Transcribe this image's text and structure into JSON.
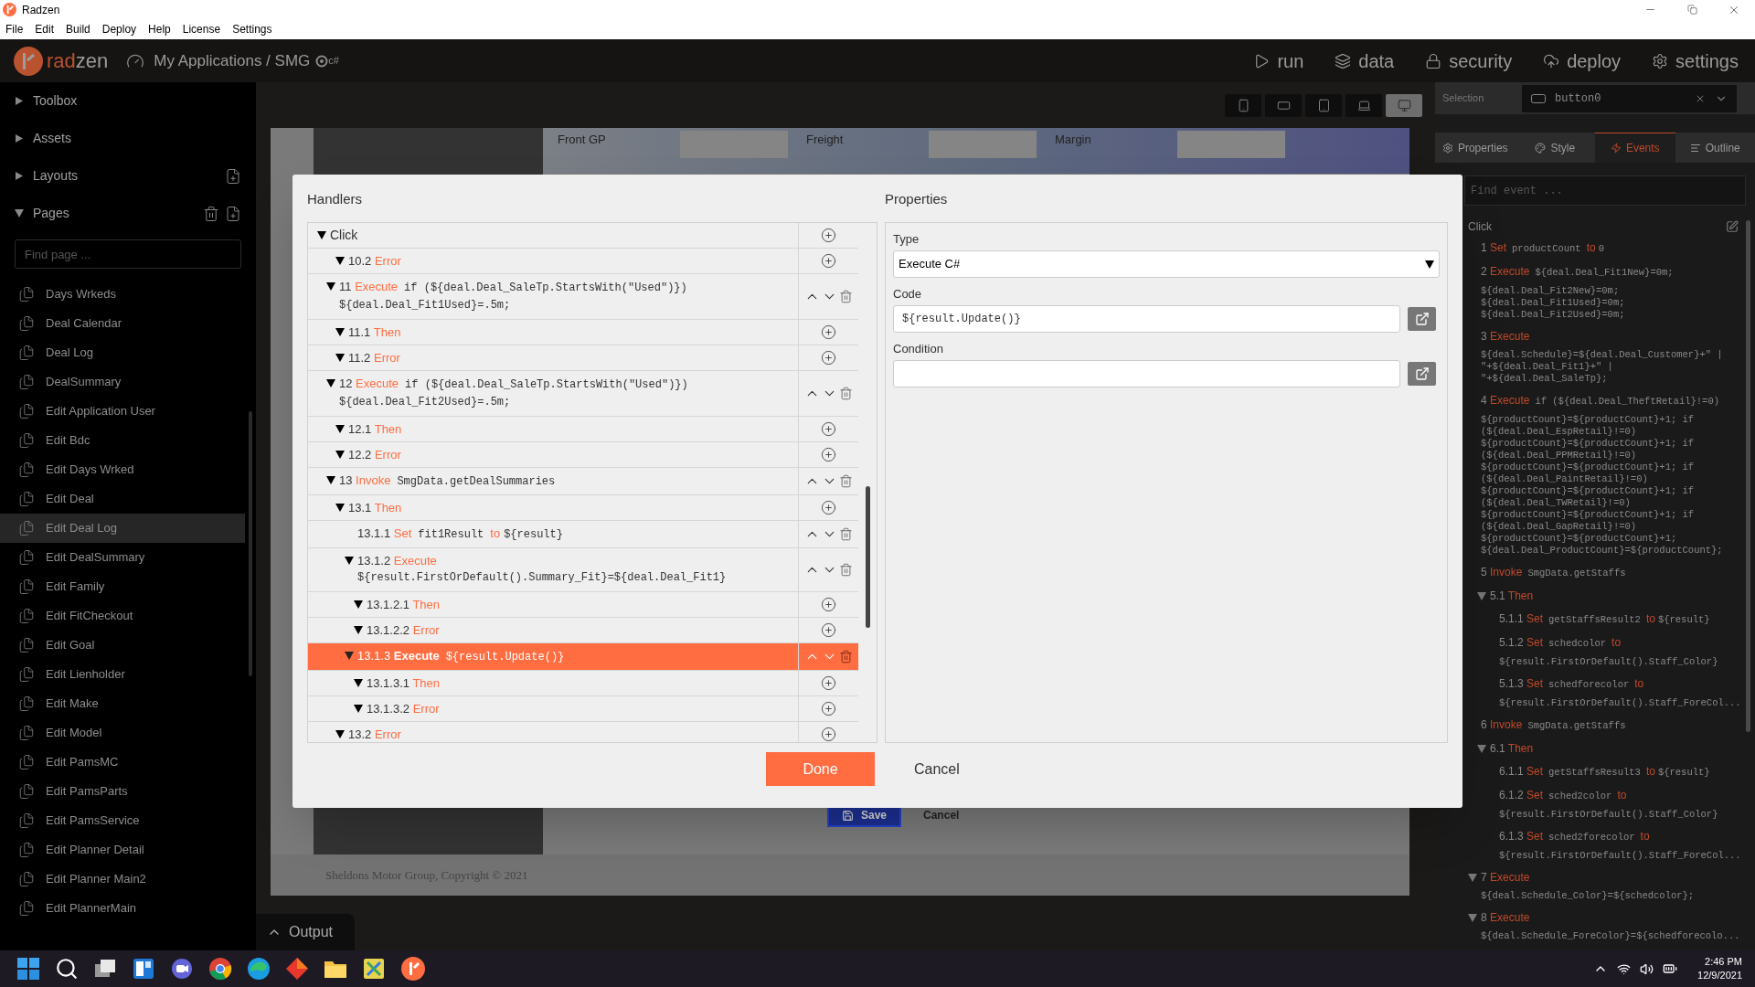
{
  "window": {
    "title": "Radzen"
  },
  "menu": [
    "File",
    "Edit",
    "Build",
    "Deploy",
    "Help",
    "License",
    "Settings"
  ],
  "app_bar": {
    "brand": {
      "accent": "rad",
      "rest": "zen"
    },
    "breadcrumb": "My Applications / SMG",
    "language": "c#",
    "nav": [
      {
        "label": "run"
      },
      {
        "label": "data"
      },
      {
        "label": "security"
      },
      {
        "label": "deploy"
      },
      {
        "label": "settings"
      }
    ]
  },
  "sidebar": {
    "sections": [
      {
        "label": "Toolbox",
        "expanded": false
      },
      {
        "label": "Assets",
        "expanded": false
      },
      {
        "label": "Layouts",
        "expanded": false
      },
      {
        "label": "Pages",
        "expanded": true
      }
    ],
    "search": {
      "placeholder": "Find page ..."
    },
    "pages": [
      {
        "label": "Days Wrkeds",
        "selected": false
      },
      {
        "label": "Deal Calendar",
        "selected": false
      },
      {
        "label": "Deal Log",
        "selected": false
      },
      {
        "label": "DealSummary",
        "selected": false
      },
      {
        "label": "Edit Application User",
        "selected": false
      },
      {
        "label": "Edit Bdc",
        "selected": false
      },
      {
        "label": "Edit Days Wrked",
        "selected": false
      },
      {
        "label": "Edit Deal",
        "selected": false
      },
      {
        "label": "Edit Deal Log",
        "selected": true
      },
      {
        "label": "Edit DealSummary",
        "selected": false
      },
      {
        "label": "Edit Family",
        "selected": false
      },
      {
        "label": "Edit FitCheckout",
        "selected": false
      },
      {
        "label": "Edit Goal",
        "selected": false
      },
      {
        "label": "Edit Lienholder",
        "selected": false
      },
      {
        "label": "Edit Make",
        "selected": false
      },
      {
        "label": "Edit Model",
        "selected": false
      },
      {
        "label": "Edit PamsMC",
        "selected": false
      },
      {
        "label": "Edit PamsParts",
        "selected": false
      },
      {
        "label": "Edit PamsService",
        "selected": false
      },
      {
        "label": "Edit Planner Detail",
        "selected": false
      },
      {
        "label": "Edit Planner Main2",
        "selected": false
      },
      {
        "label": "Edit PlannerMain",
        "selected": false
      }
    ]
  },
  "device_bar": {
    "devices": [
      {
        "selected": false
      },
      {
        "selected": false
      },
      {
        "selected": false
      },
      {
        "selected": false
      },
      {
        "selected": true
      }
    ]
  },
  "canvas": {
    "columns": [
      "Front GP",
      "Freight",
      "Margin"
    ],
    "save_button": "Save",
    "cancel_button": "Cancel",
    "footer": "Sheldons Motor Group, Copyright © 2021"
  },
  "output_tab": {
    "label": "Output"
  },
  "inspector": {
    "selection_label": "Selection",
    "selection_value": "button0",
    "tabs": [
      {
        "label": "Properties",
        "selected": false
      },
      {
        "label": "Style",
        "selected": false
      },
      {
        "label": "Events",
        "selected": true
      },
      {
        "label": "Outline",
        "selected": false
      }
    ],
    "search": {
      "placeholder": "Find event ..."
    },
    "event": "Click",
    "steps": [
      {
        "num": "1",
        "action": "Set",
        "code": "productCount",
        "connector": "to",
        "value": "0"
      },
      {
        "num": "2",
        "action": "Execute",
        "code": "${deal.Deal_Fit1New}=0m;",
        "lines": [
          "${deal.Deal_Fit2New}=0m;",
          "${deal.Deal_Fit1Used}=0m;",
          "${deal.Deal_Fit2Used}=0m;"
        ]
      },
      {
        "num": "3",
        "action": "Execute",
        "lines": [
          "${deal.Schedule}=${deal.Deal_Customer}+\" |",
          "\"+${deal.Deal_Fit1}+\" |",
          "\"+${deal.Deal_SaleTp};"
        ]
      },
      {
        "num": "4",
        "action": "Execute",
        "code": "if (${deal.Deal_TheftRetail}!=0)",
        "lines": [
          "${productCount}=${productCount}+1; if",
          "(${deal.Deal_EspRetail}!=0)",
          "${productCount}=${productCount}+1; if",
          "(${deal.Deal_PPMRetail}!=0)",
          "${productCount}=${productCount}+1; if",
          "(${deal.Deal_PaintRetail}!=0)",
          "${productCount}=${productCount}+1; if",
          "(${deal.Deal_TWRetail}!=0)",
          "${productCount}=${productCount}+1; if",
          "(${deal.Deal_GapRetail}!=0)",
          "${productCount}=${productCount}+1;",
          "${deal.Deal_ProductCount}=${productCount};"
        ]
      },
      {
        "num": "5",
        "action": "Invoke",
        "code": "SmgData.getStaffs",
        "children": [
          {
            "num": "5.1",
            "action": "Then",
            "expanded": true,
            "children": [
              {
                "num": "5.1.1",
                "action": "Set",
                "code": "getStaffsResult2",
                "connector": "to",
                "value": "${result}"
              },
              {
                "num": "5.1.2",
                "action": "Set",
                "code": "schedcolor",
                "connector": "to",
                "lines": [
                  "${result.FirstOrDefault().Staff_Color}"
                ]
              },
              {
                "num": "5.1.3",
                "action": "Set",
                "code": "schedforecolor",
                "connector": "to",
                "lines": [
                  "${result.FirstOrDefault().Staff_ForeCol..."
                ]
              }
            ]
          }
        ]
      },
      {
        "num": "6",
        "action": "Invoke",
        "code": "SmgData.getStaffs",
        "children": [
          {
            "num": "6.1",
            "action": "Then",
            "expanded": true,
            "children": [
              {
                "num": "6.1.1",
                "action": "Set",
                "code": "getStaffsResult3",
                "connector": "to",
                "value": "${result}"
              },
              {
                "num": "6.1.2",
                "action": "Set",
                "code": "sched2color",
                "connector": "to",
                "lines": [
                  "${result.FirstOrDefault().Staff_Color}"
                ]
              },
              {
                "num": "6.1.3",
                "action": "Set",
                "code": "sched2forecolor",
                "connector": "to",
                "lines": [
                  "${result.FirstOrDefault().Staff_ForeCol..."
                ]
              }
            ]
          }
        ]
      },
      {
        "num": "7",
        "action": "Execute",
        "expanded": true,
        "lines": [
          "${deal.Schedule_Color}=${schedcolor};"
        ]
      },
      {
        "num": "8",
        "action": "Execute",
        "expanded": true,
        "lines": [
          "${deal.Schedule_ForeColor}=${schedforecolo..."
        ]
      }
    ]
  },
  "dialog": {
    "handlers_title": "Handlers",
    "properties_title": "Properties",
    "tree": {
      "label": "Click",
      "kind": "event",
      "expanded": true,
      "selected": false,
      "children": [
        {
          "children": [
            {
              "num": "10.2",
              "action": "Error",
              "kind": "branch",
              "expanded": true,
              "selected": false
            }
          ]
        },
        {
          "num": "11",
          "action": "Execute",
          "code": "if (${deal.Deal_SaleTp.StartsWith(\"Used\")})",
          "lines": [
            "${deal.Deal_Fit1Used}=.5m;"
          ],
          "kind": "action",
          "expanded": true,
          "selected": false,
          "children": [
            {
              "num": "11.1",
              "action": "Then",
              "kind": "branch",
              "expanded": true,
              "selected": false
            },
            {
              "num": "11.2",
              "action": "Error",
              "kind": "branch",
              "expanded": true,
              "selected": false
            }
          ]
        },
        {
          "num": "12",
          "action": "Execute",
          "code": "if (${deal.Deal_SaleTp.StartsWith(\"Used\")})",
          "lines": [
            "${deal.Deal_Fit2Used}=.5m;"
          ],
          "kind": "action",
          "expanded": true,
          "selected": false,
          "children": [
            {
              "num": "12.1",
              "action": "Then",
              "kind": "branch",
              "expanded": true,
              "selected": false
            },
            {
              "num": "12.2",
              "action": "Error",
              "kind": "branch",
              "expanded": true,
              "selected": false
            }
          ]
        },
        {
          "num": "13",
          "action": "Invoke",
          "code": "SmgData.getDealSummaries",
          "kind": "action",
          "expanded": true,
          "selected": false,
          "children": [
            {
              "num": "13.1",
              "action": "Then",
              "kind": "branch",
              "expanded": true,
              "selected": false,
              "children": [
                {
                  "num": "13.1.1",
                  "action": "Set",
                  "code": "fit1Result",
                  "connector": "to",
                  "value": "${result}",
                  "kind": "action",
                  "selected": false
                },
                {
                  "num": "13.1.2",
                  "action": "Execute",
                  "lines": [
                    "${result.FirstOrDefault().Summary_Fit}=${deal.Deal_Fit1}"
                  ],
                  "kind": "action",
                  "expanded": true,
                  "selected": false,
                  "children": [
                    {
                      "num": "13.1.2.1",
                      "action": "Then",
                      "kind": "branch",
                      "expanded": true,
                      "selected": false
                    },
                    {
                      "num": "13.1.2.2",
                      "action": "Error",
                      "kind": "branch",
                      "expanded": true,
                      "selected": false
                    }
                  ]
                },
                {
                  "num": "13.1.3",
                  "action": "Execute",
                  "code": "${result.Update()}",
                  "kind": "action",
                  "expanded": true,
                  "selected": true,
                  "children": [
                    {
                      "num": "13.1.3.1",
                      "action": "Then",
                      "kind": "branch",
                      "expanded": true,
                      "selected": false
                    },
                    {
                      "num": "13.1.3.2",
                      "action": "Error",
                      "kind": "branch",
                      "expanded": true,
                      "selected": false
                    }
                  ]
                }
              ]
            },
            {
              "num": "13.2",
              "action": "Error",
              "kind": "branch",
              "expanded": true,
              "selected": false
            }
          ]
        }
      ]
    },
    "type_label": "Type",
    "type_value": "Execute C#",
    "code_label": "Code",
    "code_value": "${result.Update()}",
    "condition_label": "Condition",
    "buttons": [
      {
        "label": "Done",
        "kind": "primary"
      },
      {
        "label": "Cancel",
        "kind": "plain"
      }
    ]
  },
  "taskbar": {
    "time": "2:46 PM",
    "date": "12/9/2021"
  }
}
